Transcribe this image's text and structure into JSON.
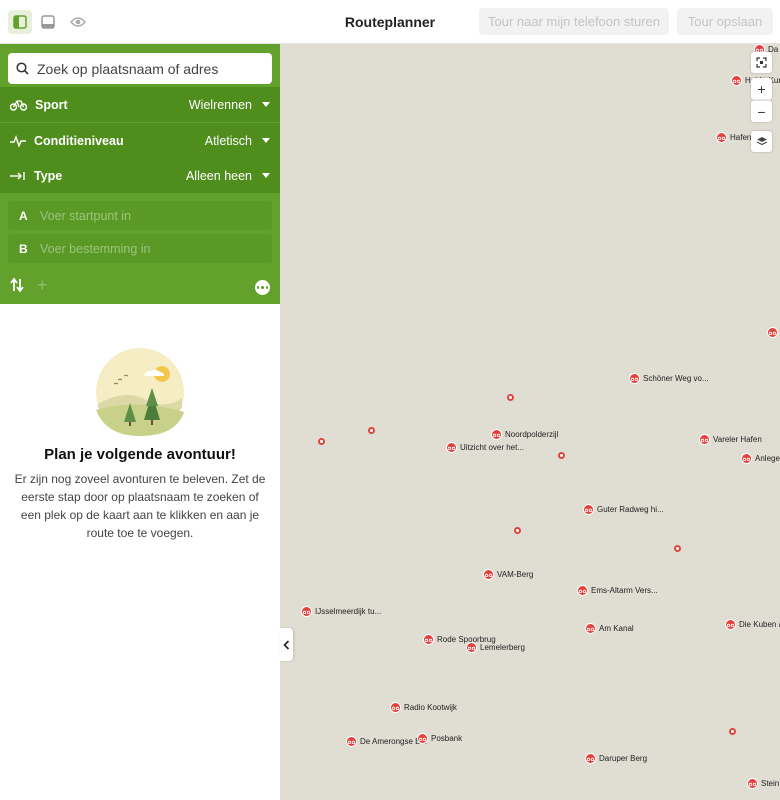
{
  "topbar": {
    "title": "Routeplanner",
    "send_button": "Tour naar mijn telefoon sturen",
    "save_button": "Tour opslaan"
  },
  "search": {
    "placeholder": "Zoek op plaatsnaam of adres"
  },
  "options": [
    {
      "label": "Sport",
      "value": "Wielrennen",
      "icon": "road-bike-icon"
    },
    {
      "label": "Conditieniveau",
      "value": "Atletisch",
      "icon": "pulse-icon"
    },
    {
      "label": "Type",
      "value": "Alleen heen",
      "icon": "arrow-to-icon"
    }
  ],
  "points": [
    {
      "letter": "A",
      "placeholder": "Voer startpunt in"
    },
    {
      "letter": "B",
      "placeholder": "Voer bestemming in"
    }
  ],
  "empty": {
    "title": "Plan je volgende avontuur!",
    "text": "Er zijn nog zoveel avonturen te beleven. Zet de eerste stap door op plaatsnaam te zoeken of een plek op de kaart aan te klikken en aan je route toe te voegen."
  },
  "map": {
    "markers": [
      {
        "label": "Da"
      },
      {
        "label": "Heide-Kurz"
      },
      {
        "label": "Hafen"
      },
      {
        "label": ""
      },
      {
        "label": "Schöner Weg vo..."
      },
      {
        "label": "Noordpolderzijl"
      },
      {
        "label": "Uitzicht over het..."
      },
      {
        "label": "Vareler Hafen"
      },
      {
        "label": "Anlege"
      },
      {
        "label": "Guter Radweg hi..."
      },
      {
        "label": "VAM-Berg"
      },
      {
        "label": "Ems-Altarm Vers..."
      },
      {
        "label": "IJsselmeerdijk tu..."
      },
      {
        "label": "Am Kanal"
      },
      {
        "label": "Die Kuben a"
      },
      {
        "label": "Rode Spoorbrug"
      },
      {
        "label": "Lemelerberg"
      },
      {
        "label": "Radio Kootwijk"
      },
      {
        "label": "De Amerongse B..."
      },
      {
        "label": "Posbank"
      },
      {
        "label": "Daruper Berg"
      },
      {
        "label": "Stein"
      }
    ]
  }
}
